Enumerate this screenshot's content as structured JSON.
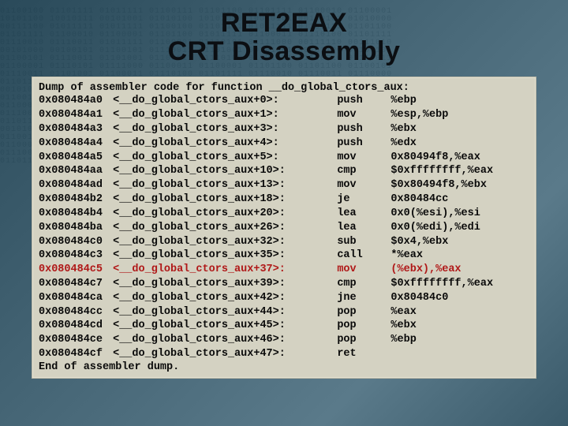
{
  "title": {
    "line1": "RET2EAX",
    "line2": "CRT Disassembly"
  },
  "dump": {
    "header": "Dump of assembler code for function __do_global_ctors_aux:",
    "footer": "End of assembler dump.",
    "highlight_index": 12,
    "rows": [
      {
        "addr": "0x080484a0",
        "sym": "<__do_global_ctors_aux+0>:",
        "op": "push",
        "args": "%ebp"
      },
      {
        "addr": "0x080484a1",
        "sym": "<__do_global_ctors_aux+1>:",
        "op": "mov",
        "args": "%esp,%ebp"
      },
      {
        "addr": "0x080484a3",
        "sym": "<__do_global_ctors_aux+3>:",
        "op": "push",
        "args": "%ebx"
      },
      {
        "addr": "0x080484a4",
        "sym": "<__do_global_ctors_aux+4>:",
        "op": "push",
        "args": "%edx"
      },
      {
        "addr": "0x080484a5",
        "sym": "<__do_global_ctors_aux+5>:",
        "op": "mov",
        "args": "0x80494f8,%eax"
      },
      {
        "addr": "0x080484aa",
        "sym": "<__do_global_ctors_aux+10>:",
        "op": "cmp",
        "args": "$0xffffffff,%eax"
      },
      {
        "addr": "0x080484ad",
        "sym": "<__do_global_ctors_aux+13>:",
        "op": "mov",
        "args": "$0x80494f8,%ebx"
      },
      {
        "addr": "0x080484b2",
        "sym": "<__do_global_ctors_aux+18>:",
        "op": "je",
        "args": "0x80484cc"
      },
      {
        "addr": "0x080484b4",
        "sym": "<__do_global_ctors_aux+20>:",
        "op": "lea",
        "args": "0x0(%esi),%esi"
      },
      {
        "addr": "0x080484ba",
        "sym": "<__do_global_ctors_aux+26>:",
        "op": "lea",
        "args": "0x0(%edi),%edi"
      },
      {
        "addr": "0x080484c0",
        "sym": "<__do_global_ctors_aux+32>:",
        "op": "sub",
        "args": "$0x4,%ebx"
      },
      {
        "addr": "0x080484c3",
        "sym": "<__do_global_ctors_aux+35>:",
        "op": "call",
        "args": "*%eax"
      },
      {
        "addr": "0x080484c5",
        "sym": "<__do_global_ctors_aux+37>:",
        "op": "mov",
        "args": "(%ebx),%eax"
      },
      {
        "addr": "0x080484c7",
        "sym": "<__do_global_ctors_aux+39>:",
        "op": "cmp",
        "args": "$0xffffffff,%eax"
      },
      {
        "addr": "0x080484ca",
        "sym": "<__do_global_ctors_aux+42>:",
        "op": "jne",
        "args": "0x80484c0"
      },
      {
        "addr": "0x080484cc",
        "sym": "<__do_global_ctors_aux+44>:",
        "op": "pop",
        "args": "%eax"
      },
      {
        "addr": "0x080484cd",
        "sym": "<__do_global_ctors_aux+45>:",
        "op": "pop",
        "args": "%ebx"
      },
      {
        "addr": "0x080484ce",
        "sym": "<__do_global_ctors_aux+46>:",
        "op": "pop",
        "args": "%ebp"
      },
      {
        "addr": "0x080484cf",
        "sym": "<__do_global_ctors_aux+47>:",
        "op": "ret",
        "args": ""
      }
    ]
  }
}
